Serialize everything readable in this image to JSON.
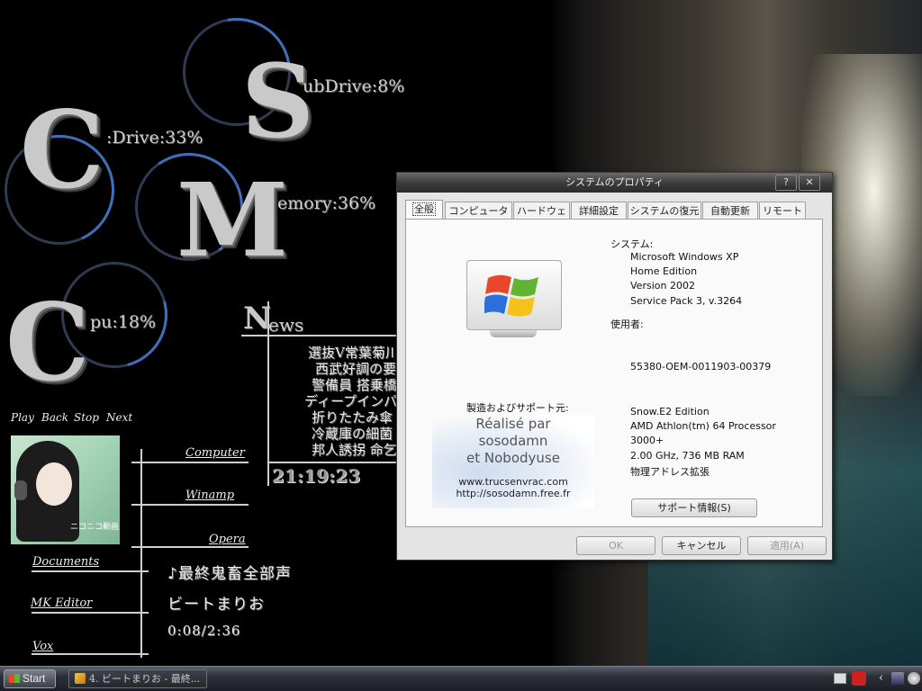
{
  "gauges": {
    "c_drive": {
      "letter": "C",
      "label": ":Drive:33%",
      "percent": 33
    },
    "sub_drive": {
      "letter": "S",
      "label": "ubDrive:8%",
      "percent": 8
    },
    "memory": {
      "letter": "M",
      "label": "emory:36%",
      "percent": 36
    },
    "cpu": {
      "letter": "C",
      "label": "pu:18%",
      "percent": 18
    }
  },
  "news": {
    "heading_initial": "N",
    "heading_rest": "ews",
    "items": [
      "選抜V常葉菊川",
      "西武好調の要",
      "警備員 搭乗橋",
      "ディープインパ",
      "折りたたみ傘",
      "冷蔵庫の細菌",
      "邦人誘拐 命乞"
    ]
  },
  "clock": "21:19:23",
  "media": {
    "play": "Play",
    "back": "Back",
    "stop": "Stop",
    "next": "Next",
    "album_caption": "ニコニコ動画",
    "track_title": "♪最終鬼畜全部声",
    "artist": "ビートまりお",
    "time": "0:08/2:36"
  },
  "launcher": {
    "computer": "Computer",
    "winamp": "Winamp",
    "opera": "Opera",
    "documents": "Documents",
    "mk_editor": "MK Editor",
    "vox": "Vox"
  },
  "dialog": {
    "title": "システムのプロパティ",
    "tabs": [
      "全般",
      "コンピュータ名",
      "ハードウェア",
      "詳細設定",
      "システムの復元",
      "自動更新",
      "リモート"
    ],
    "system_label": "システム:",
    "system_lines": [
      "Microsoft Windows XP",
      "Home Edition",
      "Version 2002",
      "Service Pack 3, v.3264"
    ],
    "user_label": "使用者:",
    "product_id": "55380-OEM-0011903-00379",
    "manufacturer_label": "製造およびサポート元:",
    "oem_logo_lines": [
      "Réalisé par",
      "sosodamn",
      "et Nobodyuse"
    ],
    "oem_logo_urls": [
      "www.trucsenvrac.com",
      "http://sosodamn.free.fr"
    ],
    "manufacturer_lines": [
      "Snow.E2 Edition",
      "AMD Athlon(tm) 64 Processor",
      "3000+",
      "2.00 GHz, 736 MB RAM",
      "物理アドレス拡張"
    ],
    "support_info_button": "サポート情報(S)",
    "ok_button": "OK",
    "cancel_button": "キャンセル",
    "apply_button": "適用(A)"
  },
  "taskbar": {
    "start_label": "Start",
    "task_label": "4. ビートまりお - 最終..."
  },
  "colors": {
    "gauge_ring": "#2f3b52",
    "gauge_arc": "#3f6fb8",
    "dialog_bg": "#e4e4e4"
  }
}
